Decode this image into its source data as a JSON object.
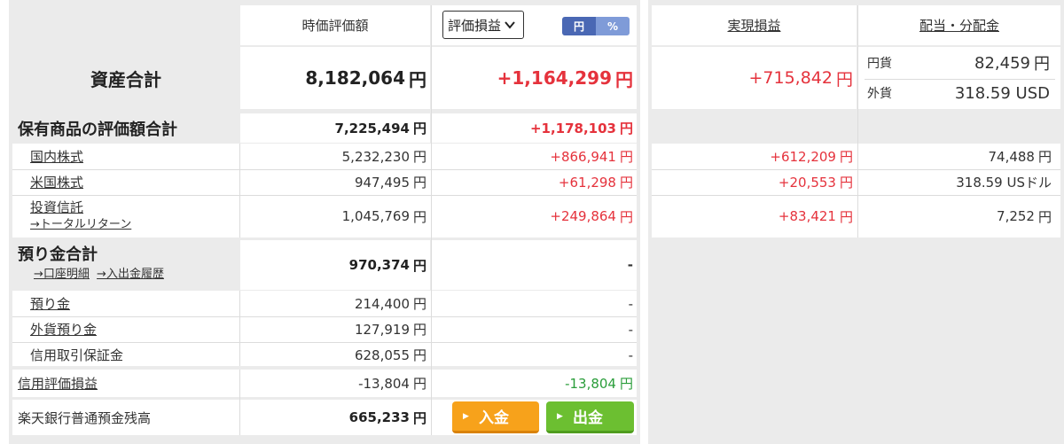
{
  "header": {
    "market_value": "時価評価額",
    "gain_select": "評価損益",
    "toggle_yen": "円",
    "toggle_pct": "%",
    "realized": "実現損益",
    "dividend": "配当・分配金"
  },
  "total": {
    "label": "資産合計",
    "value": "8,182,064",
    "gain": "+1,164,299",
    "realized": "+715,842",
    "div_jpy_label": "円貨",
    "div_jpy": "82,459",
    "div_fx_label": "外貨",
    "div_fx": "318.59 USD"
  },
  "holdings": {
    "label": "保有商品の評価額合計",
    "value": "7,225,494",
    "gain": "+1,178,103",
    "rows": [
      {
        "label": "国内株式",
        "value": "5,232,230",
        "gain": "+866,941",
        "realized": "+612,209",
        "dividend": "74,488"
      },
      {
        "label": "米国株式",
        "value": "947,495",
        "gain": "+61,298",
        "realized": "+20,553",
        "dividend": "318.59 USドル"
      },
      {
        "label": "投資信託",
        "sub_link": "→トータルリターン",
        "value": "1,045,769",
        "gain": "+249,864",
        "realized": "+83,421",
        "dividend": "7,252"
      }
    ]
  },
  "deposit": {
    "label": "預り金合計",
    "link1": "→口座明細",
    "link2": "→入出金履歴",
    "value": "970,374",
    "gain": "-",
    "rows": [
      {
        "label": "預り金",
        "value": "214,400",
        "gain": "-"
      },
      {
        "label": "外貨預り金",
        "value": "127,919",
        "gain": "-"
      },
      {
        "label": "信用取引保証金",
        "value": "628,055",
        "gain": "-"
      }
    ]
  },
  "margin": {
    "label": "信用評価損益",
    "value": "-13,804",
    "gain": "-13,804"
  },
  "bank": {
    "label": "楽天銀行普通預金残高",
    "value": "665,233",
    "deposit_btn": "入金",
    "withdraw_btn": "出金"
  },
  "unit": "円",
  "colors": {
    "gain_red": "#e5323c",
    "gain_green": "#2a9d3a",
    "toggle_blue": "#4a68b4",
    "btn_orange": "#f7a21b",
    "btn_green": "#6cbf31"
  }
}
